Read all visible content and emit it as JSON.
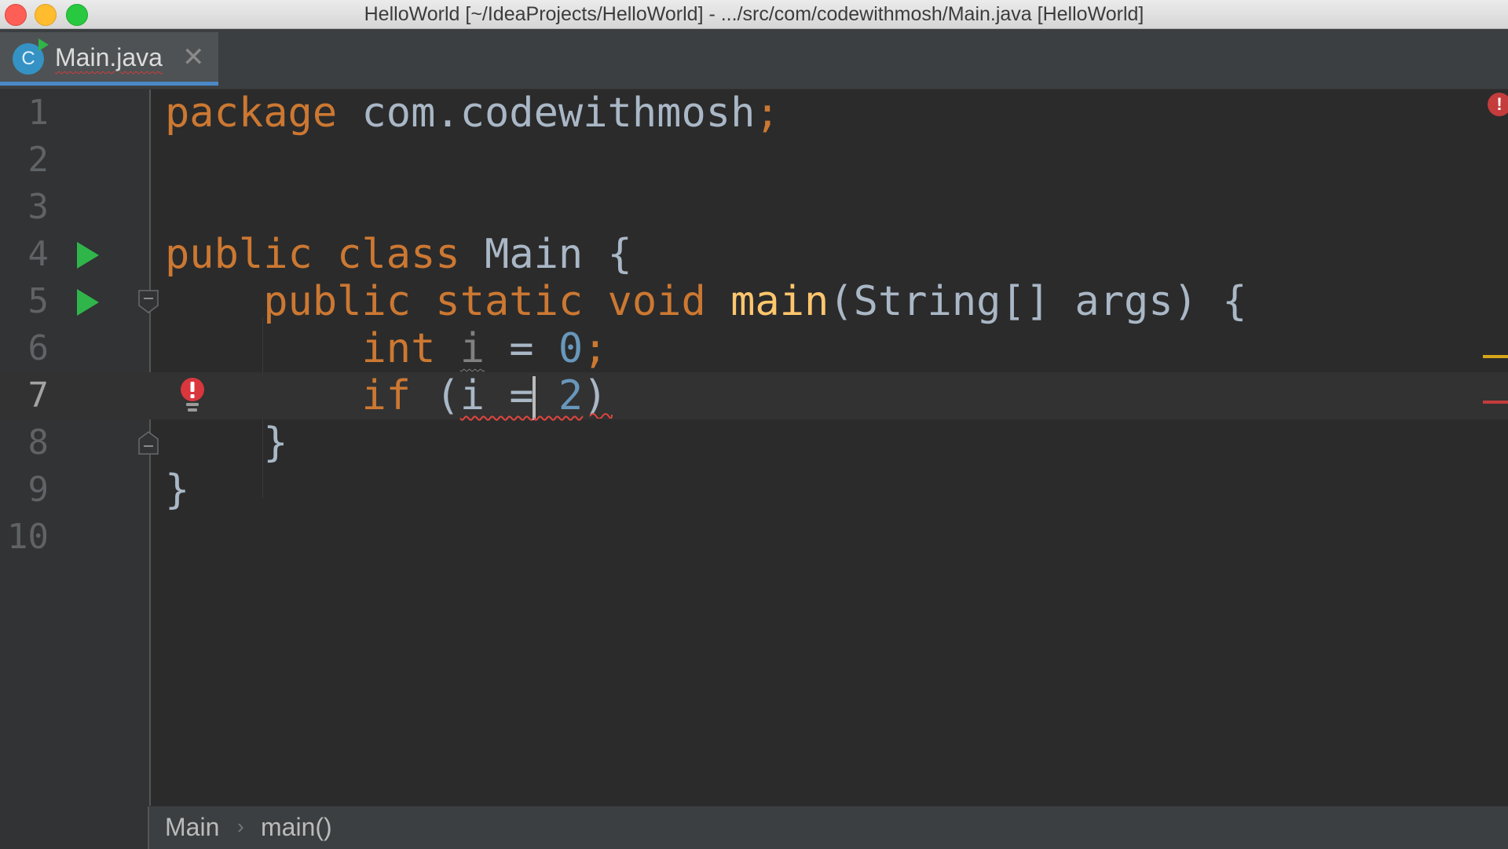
{
  "window": {
    "title": "HelloWorld [~/IdeaProjects/HelloWorld] - .../src/com/codewithmosh/Main.java [HelloWorld]"
  },
  "tab": {
    "icon_letter": "C",
    "label": "Main.java",
    "close_glyph": "✕"
  },
  "editor": {
    "line_numbers": [
      "1",
      "2",
      "3",
      "4",
      "5",
      "6",
      "7",
      "8",
      "9",
      "10"
    ],
    "current_line": "7",
    "code": {
      "l1_kw": "package",
      "l1_rest": " com.codewithmosh",
      "l1_semi": ";",
      "l4_kw1": "public",
      "l4_kw2": "class",
      "l4_rest": " Main {",
      "l5_kw1": "public",
      "l5_kw2": "static",
      "l5_kw3": "void",
      "l5_fn": "main",
      "l5_rest": "(String[] args) {",
      "l6_kw": "int",
      "l6_var": "i",
      "l6_eq": " = ",
      "l6_num": "0",
      "l6_semi": ";",
      "l7_kw": "if",
      "l7_open": " (",
      "l7_err": "i =",
      "l7_err_num": " 2",
      "l7_close": ")",
      "l8": "}",
      "l9": "}"
    }
  },
  "icons": {
    "run": "run-gutter-icon",
    "fold": "fold-icon",
    "bulb": "error-bulb-icon",
    "error_badge": "!"
  },
  "colors": {
    "keyword": "#cc7832",
    "number": "#6897bb",
    "function": "#ffc66d",
    "error": "#e0453e",
    "warning": "#d7a51a",
    "run": "#2fb54a"
  },
  "breadcrumb": {
    "items": [
      "Main",
      "main()"
    ],
    "separator": "›"
  }
}
